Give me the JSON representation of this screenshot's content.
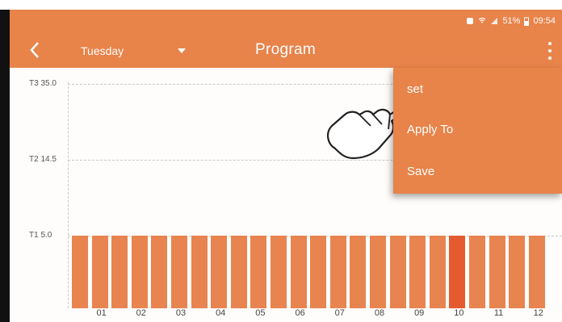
{
  "status_bar": {
    "battery": "51%",
    "time": "09:54",
    "icons": [
      "alarm-icon",
      "wifi-icon",
      "signal-icon",
      "battery-icon"
    ]
  },
  "app_bar": {
    "back_icon": "chevron-left-icon",
    "day": "Tuesday",
    "title": "Program",
    "more_icon": "more-vert-icon"
  },
  "menu": {
    "items": [
      {
        "label": "set"
      },
      {
        "label": "Apply To"
      },
      {
        "label": "Save"
      }
    ]
  },
  "chart_data": {
    "type": "bar",
    "y_ticks": [
      "T3 35.0",
      "T2 14.5",
      "T1 5.0"
    ],
    "x_tick_labels": [
      "01",
      "02",
      "03",
      "04",
      "05",
      "06",
      "07",
      "08",
      "09",
      "10",
      "11",
      "12"
    ],
    "values": [
      5,
      5,
      5,
      5,
      5,
      5,
      5,
      5,
      5,
      5,
      5,
      5,
      5,
      5,
      5,
      5,
      5,
      5,
      5,
      5,
      5,
      5,
      5,
      5,
      5,
      5,
      5,
      5,
      5,
      5,
      5,
      5,
      5,
      5,
      5,
      5,
      5,
      5,
      5,
      5,
      5,
      5,
      5,
      5,
      5,
      5,
      5,
      5
    ],
    "visible_slots": 24,
    "highlight_slot": 19,
    "colors": {
      "bar": "#e8844f",
      "highlight": "#e55a2e"
    },
    "grid": true
  },
  "colors": {
    "accent": "#e8834a"
  }
}
